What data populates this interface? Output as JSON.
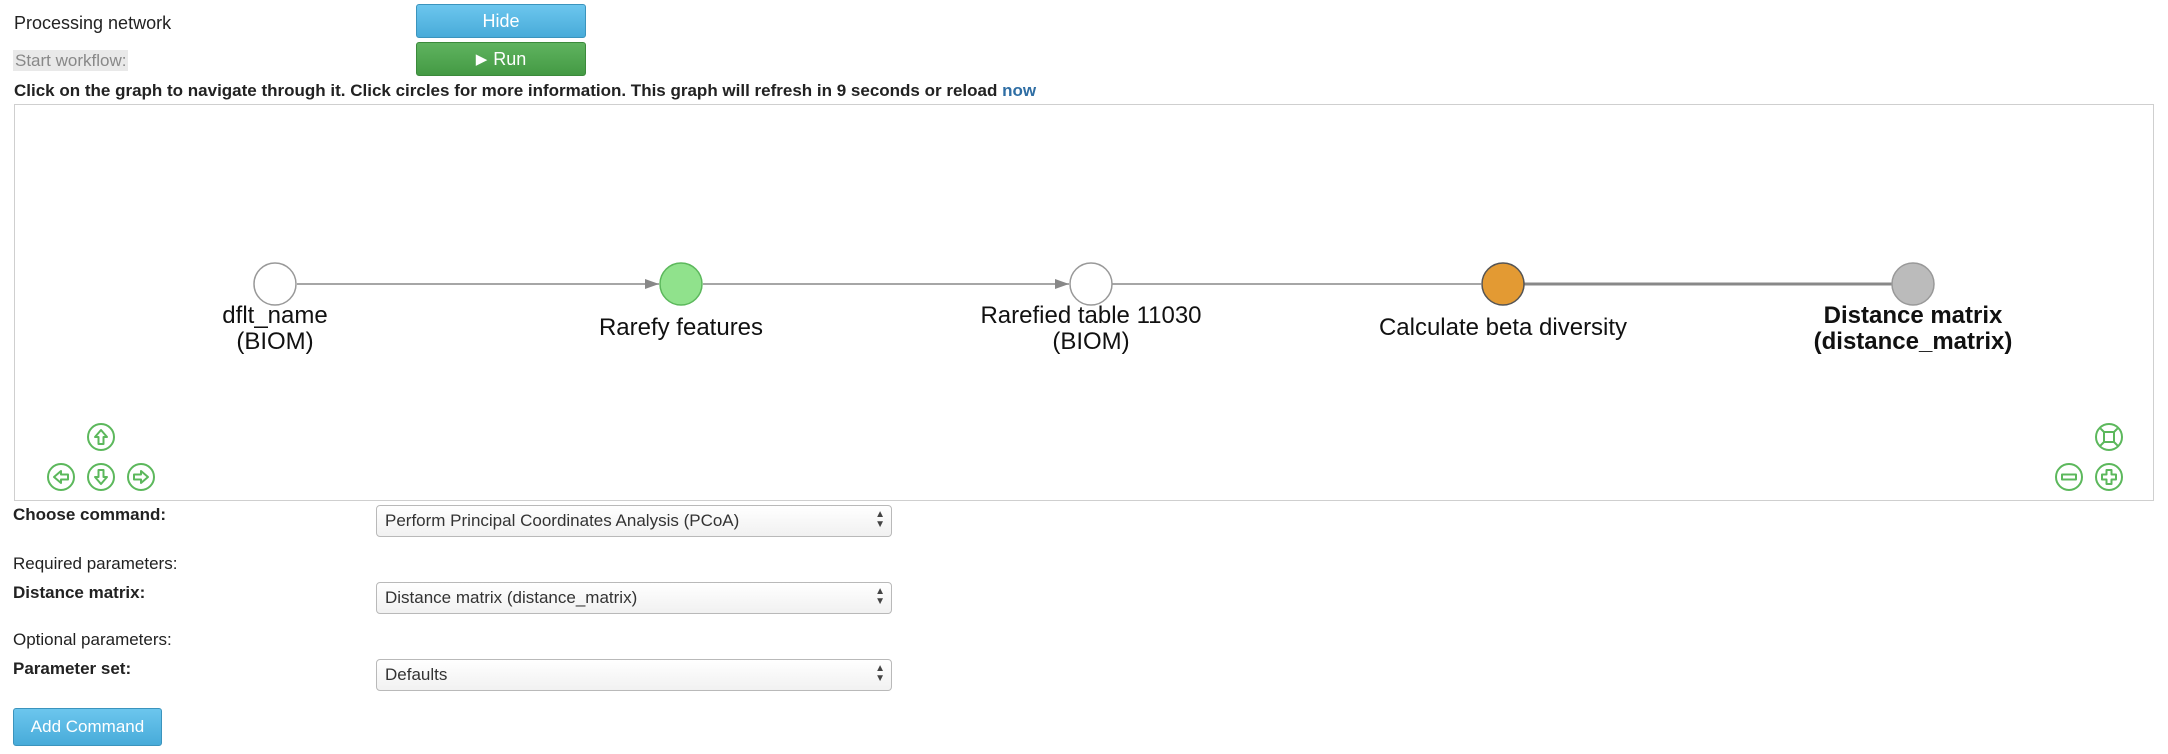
{
  "header": {
    "processing_label": "Processing network",
    "hide_button": "Hide",
    "start_workflow_label": "Start workflow:",
    "run_button": "Run",
    "note_text": "Click on the graph to navigate through it. Click circles for more information. This graph will refresh in 9 seconds or reload",
    "note_link": "now"
  },
  "graph": {
    "nodes": [
      {
        "line1": "dflt_name",
        "line2": "(BIOM)",
        "fill": "#ffffff",
        "stroke": "#999999",
        "bold": false
      },
      {
        "line1": "Rarefy features",
        "line2": "",
        "fill": "#90e28c",
        "stroke": "#5cb85c",
        "bold": false
      },
      {
        "line1": "Rarefied table 11030",
        "line2": "(BIOM)",
        "fill": "#ffffff",
        "stroke": "#999999",
        "bold": false
      },
      {
        "line1": "Calculate beta diversity",
        "line2": "",
        "fill": "#e39a33",
        "stroke": "#555555",
        "bold": false
      },
      {
        "line1": "Distance matrix",
        "line2": "(distance_matrix)",
        "fill": "#bbbbbb",
        "stroke": "#999999",
        "bold": true
      }
    ]
  },
  "form": {
    "choose_command_label": "Choose command:",
    "choose_command_value": "Perform Principal Coordinates Analysis (PCoA)",
    "required_label": "Required parameters:",
    "distance_matrix_label": "Distance matrix:",
    "distance_matrix_value": "Distance matrix (distance_matrix)",
    "optional_label": "Optional parameters:",
    "parameter_set_label": "Parameter set:",
    "parameter_set_value": "Defaults",
    "add_command_button": "Add Command"
  },
  "colors": {
    "hide_button": "#5bc0de",
    "run_button": "#4cae4c",
    "link": "#2f6ea4",
    "nav_icons": "#5cb85c"
  }
}
